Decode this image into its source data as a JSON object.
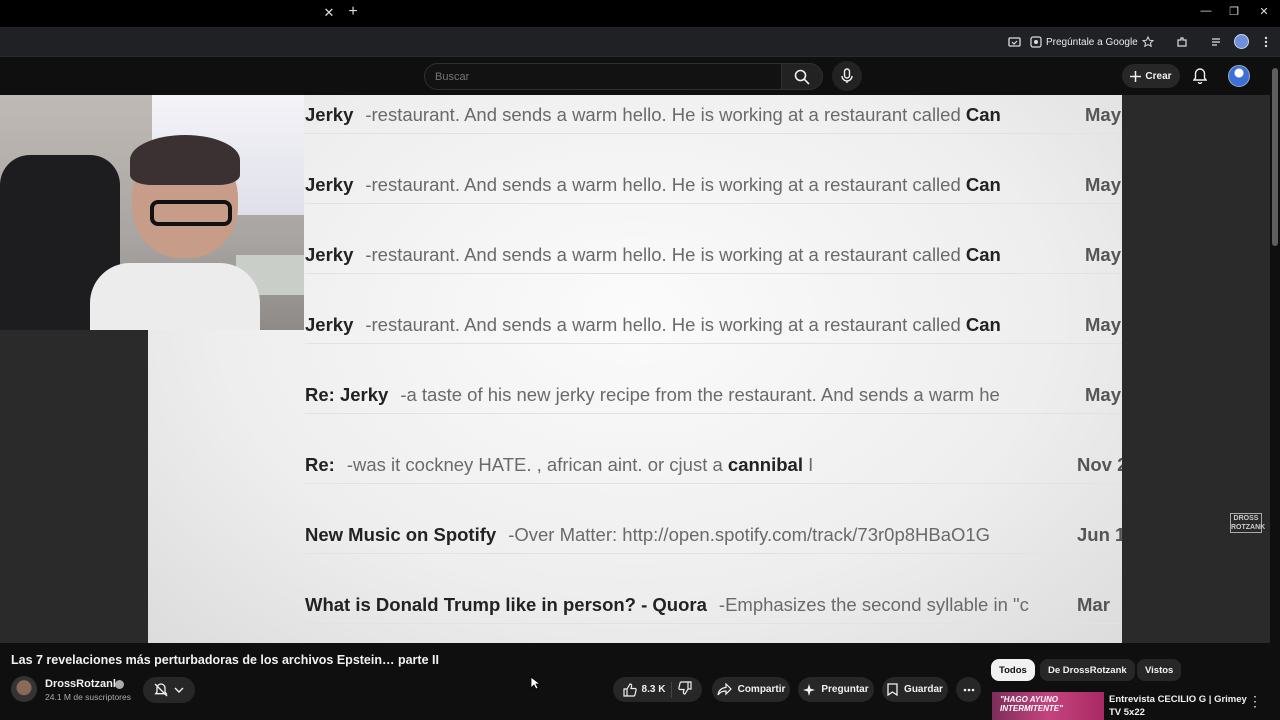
{
  "browser": {
    "ask_google_label": "Pregúntale a Google"
  },
  "header": {
    "search_placeholder": "Buscar",
    "create_label": "Crear"
  },
  "video_frame": {
    "rows": [
      {
        "sender": "Jerky",
        "snippet": "-restaurant. And sends a warm hello. He is working at a restaurant called ",
        "snippet_bold": "Can",
        "date": "May"
      },
      {
        "sender": "Jerky",
        "snippet": "-restaurant. And sends a warm hello. He is working at a restaurant called ",
        "snippet_bold": "Can",
        "date": "May"
      },
      {
        "sender": "Jerky",
        "snippet": "-restaurant. And sends a warm hello. He is working at a restaurant called ",
        "snippet_bold": "Can",
        "date": "May"
      },
      {
        "sender": "Jerky",
        "snippet": "-restaurant. And sends a warm hello. He is working at a restaurant called ",
        "snippet_bold": "Can",
        "date": "May"
      },
      {
        "sender": "Re: Jerky",
        "snippet": "-a taste of his new jerky recipe from the restaurant. And sends a warm he",
        "snippet_bold": "",
        "date": "May"
      },
      {
        "sender": "Re:",
        "snippet": "-was it cockney HATE. , african aint. or cjust a ",
        "snippet_bold": "cannibal",
        "snippet_tail": " I",
        "date": "Nov 2"
      },
      {
        "sender": "New Music on Spotify",
        "snippet": "-Over Matter: http://open.spotify.com/track/73r0p8HBaO1G",
        "snippet_bold": "",
        "date": "Jun 1"
      },
      {
        "sender": "What is Donald Trump like in person? - Quora",
        "snippet": "-Emphasizes the second syllable in \"c",
        "snippet_bold": "",
        "date": "Mar"
      }
    ],
    "watermark": "DROSS ROTZANK"
  },
  "video_info": {
    "title": "Las 7 revelaciones más perturbadoras de los archivos Epstein… parte II",
    "channel_name": "DrossRotzank",
    "subscribers": "24.1 M de suscriptores",
    "likes": "8.3 K",
    "share_label": "Compartir",
    "ask_label": "Preguntar",
    "save_label": "Guardar"
  },
  "sidebar": {
    "chips": [
      "Todos",
      "De DrossRotzank",
      "Vistos"
    ],
    "recommendation": {
      "thumb_text": "\"HAGO AYUNO INTERMITENTE\"",
      "title": "Entrevista CECILIO G | Grimey TV 5x22"
    }
  },
  "colors": {
    "background": "#0f0f0f",
    "pill": "#272727",
    "accent": "#3ea6ff"
  }
}
